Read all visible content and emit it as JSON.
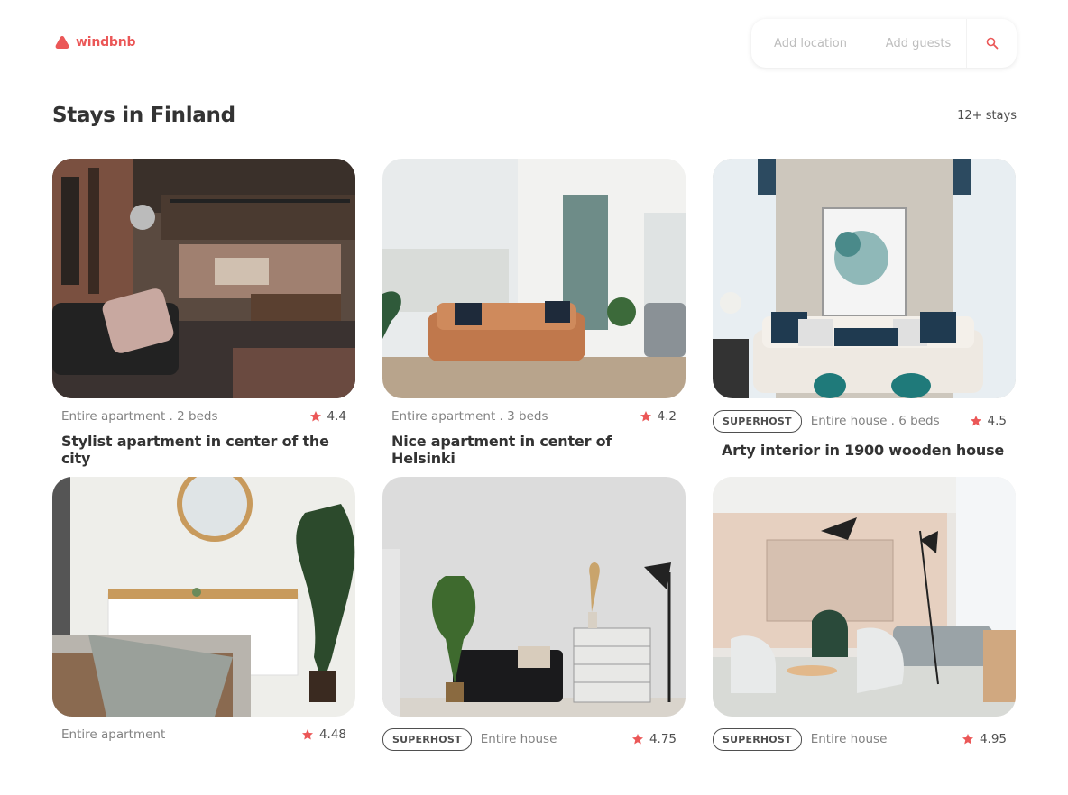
{
  "brand": {
    "name": "windbnb",
    "accent": "#eb5757"
  },
  "search": {
    "location_placeholder": "Add location",
    "guests_placeholder": "Add guests",
    "icon": "search-icon"
  },
  "page": {
    "title": "Stays in Finland",
    "count": "12+ stays"
  },
  "stays": [
    {
      "superhost": false,
      "type": "Entire apartment . 2 beds",
      "rating": "4.4",
      "title": "Stylist apartment in center of the city"
    },
    {
      "superhost": false,
      "type": "Entire apartment . 3 beds",
      "rating": "4.2",
      "title": "Nice apartment in center of Helsinki"
    },
    {
      "superhost": true,
      "badge": "SUPERHOST",
      "type": "Entire house . 6 beds",
      "rating": "4.5",
      "title": "Arty interior in 1900 wooden house"
    },
    {
      "superhost": false,
      "type": "Entire apartment",
      "rating": "4.48",
      "title": ""
    },
    {
      "superhost": true,
      "badge": "SUPERHOST",
      "type": "Entire house",
      "rating": "4.75",
      "title": ""
    },
    {
      "superhost": true,
      "badge": "SUPERHOST",
      "type": "Entire house",
      "rating": "4.95",
      "title": ""
    }
  ]
}
